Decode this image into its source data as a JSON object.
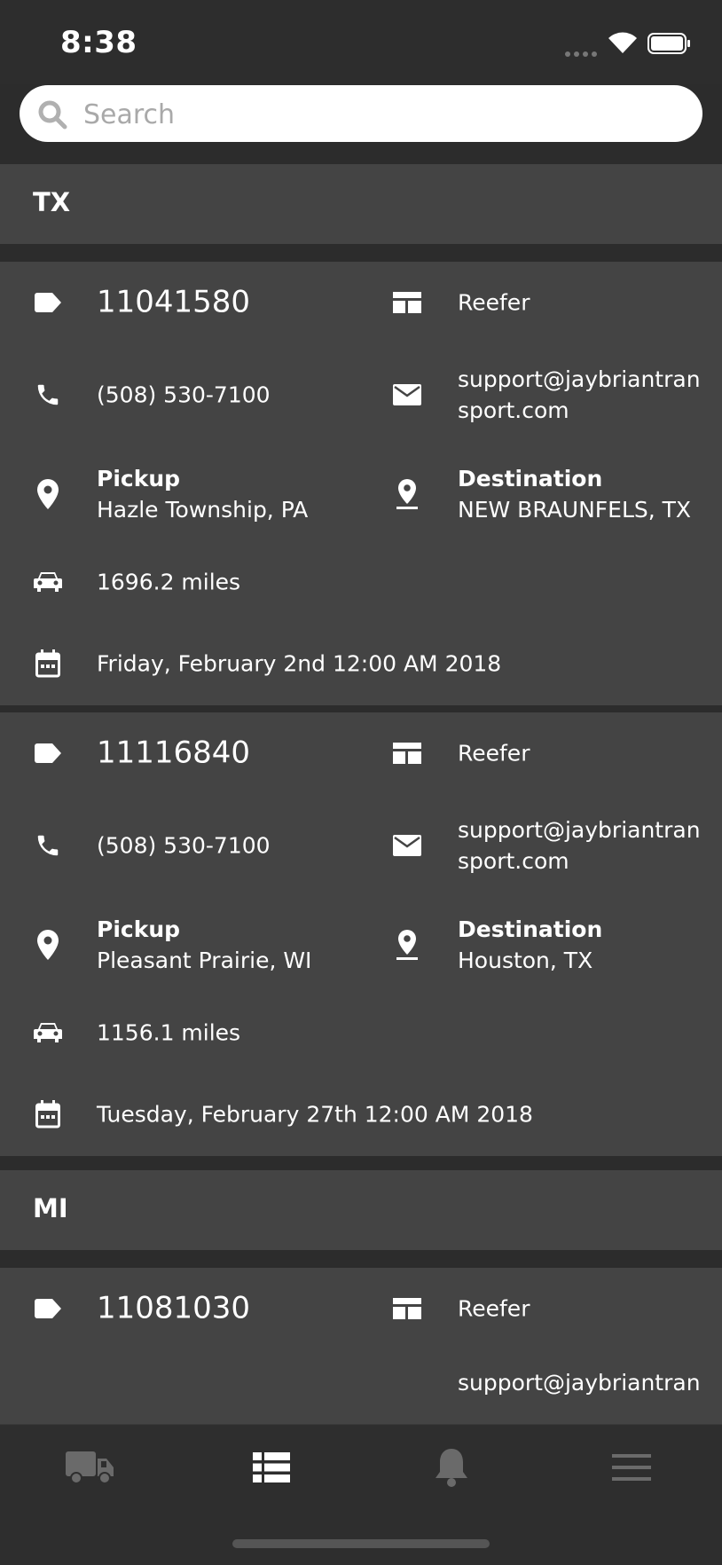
{
  "status_bar": {
    "time": "8:38"
  },
  "search": {
    "placeholder": "Search"
  },
  "sections": [
    {
      "state": "TX",
      "loads": [
        {
          "load_id": "11041580",
          "equipment": "Reefer",
          "phone": "(508) 530-7100",
          "email_line1": "support@jaybriantran",
          "email_line2": "sport.com",
          "pickup_label": "Pickup",
          "pickup": "Hazle Township, PA",
          "destination_label": "Destination",
          "destination": "NEW BRAUNFELS, TX",
          "miles": "1696.2 miles",
          "date": "Friday, February 2nd 12:00 AM 2018"
        },
        {
          "load_id": "11116840",
          "equipment": "Reefer",
          "phone": "(508) 530-7100",
          "email_line1": "support@jaybriantran",
          "email_line2": "sport.com",
          "pickup_label": "Pickup",
          "pickup": "Pleasant Prairie, WI",
          "destination_label": "Destination",
          "destination": "Houston, TX",
          "miles": "1156.1 miles",
          "date": "Tuesday, February 27th 12:00 AM 2018"
        }
      ]
    },
    {
      "state": "MI",
      "loads": [
        {
          "load_id": "11081030",
          "equipment": "Reefer",
          "email_line1": "support@jaybriantran"
        }
      ]
    }
  ],
  "tab_bar": {
    "tabs": [
      {
        "icon": "truck-icon",
        "active": false
      },
      {
        "icon": "list-icon",
        "active": true
      },
      {
        "icon": "bell-icon",
        "active": false
      },
      {
        "icon": "menu-icon",
        "active": false
      }
    ]
  },
  "colors": {
    "background": "#2c2c2c",
    "card": "#444444",
    "inactive_icon": "#6a6a6a",
    "active_icon": "#ffffff"
  }
}
